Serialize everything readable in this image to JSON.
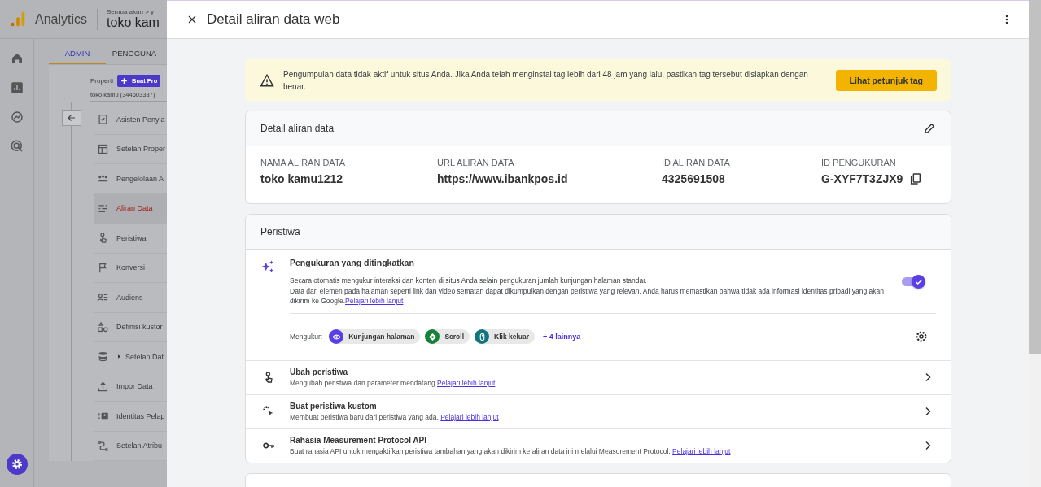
{
  "app": {
    "product": "Analytics",
    "breadcrumb": "Semua akun > y",
    "account": "toko kam",
    "tabs": [
      {
        "label": "ADMIN",
        "selected": true
      },
      {
        "label": "PENGGUNA",
        "selected": false
      }
    ],
    "property_label": "Properti",
    "create_button": "Buat Pro",
    "property": "toko kamu (344603387)",
    "menu": [
      {
        "label": "Asisten Penyia",
        "selected": false
      },
      {
        "label": "Setelan Proper",
        "selected": false
      },
      {
        "label": "Pengelolaan A",
        "selected": false
      },
      {
        "label": "Aliran Data",
        "selected": true
      },
      {
        "label": "Peristiwa",
        "selected": false
      },
      {
        "label": "Konversi",
        "selected": false
      },
      {
        "label": "Audiens",
        "selected": false
      },
      {
        "label": "Definisi kustor",
        "selected": false
      },
      {
        "label": "Setelan Dat",
        "selected": false,
        "expanded": false
      },
      {
        "label": "Impor Data",
        "selected": false
      },
      {
        "label": "Identitas Pelap",
        "selected": false
      },
      {
        "label": "Setelan Atribu",
        "selected": false
      }
    ]
  },
  "panel": {
    "title": "Detail aliran data web",
    "banner": {
      "text": "Pengumpulan data tidak aktif untuk situs Anda. Jika Anda telah menginstal tag lebih dari 48 jam yang lalu, pastikan tag tersebut disiapkan dengan benar.",
      "button": "Lihat petunjuk tag"
    },
    "stream_card": {
      "title": "Detail aliran data",
      "fields": [
        {
          "label": "NAMA ALIRAN DATA",
          "value": "toko kamu1212",
          "copy": false
        },
        {
          "label": "URL ALIRAN DATA",
          "value": "https://www.ibankpos.id",
          "copy": false
        },
        {
          "label": "ID ALIRAN DATA",
          "value": "4325691508",
          "copy": false
        },
        {
          "label": "ID PENGUKURAN",
          "value": "G-XYF7T3ZJX9",
          "copy": true
        }
      ]
    },
    "events_card": {
      "title": "Peristiwa",
      "enhanced": {
        "title": "Pengukuran yang ditingkatkan",
        "on": true,
        "description": "Secara otomatis mengukur interaksi dan konten di situs Anda selain pengukuran jumlah kunjungan halaman standar.\nData dari elemen pada halaman seperti link dan video sematan dapat dikumpulkan dengan peristiwa yang relevan. Anda harus memastikan bahwa tidak ada informasi identitas pribadi yang akan dikirim ke Google.",
        "link": "Pelajari lebih lanjut",
        "measures_label": "Mengukur:",
        "chips": [
          {
            "label": "Kunjungan halaman",
            "color": "#5b3fe6"
          },
          {
            "label": "Scroll",
            "color": "#188038"
          },
          {
            "label": "Klik keluar",
            "color": "#12757d"
          }
        ],
        "more": "+ 4 lainnya"
      },
      "rows": [
        {
          "title": "Ubah peristiwa",
          "description": "Mengubah peristiwa dan parameter mendatang",
          "link": "Pelajari lebih lanjut"
        },
        {
          "title": "Buat peristiwa kustom",
          "description": "Membuat peristiwa baru dari peristiwa yang ada.",
          "link": "Pelajari lebih lanjut"
        },
        {
          "title": "Rahasia Measurement Protocol API",
          "description": "Buat rahasia API untuk mengaktifkan peristiwa tambahan yang akan dikirim ke aliran data ini melalui Measurement Protocol.",
          "link": "Pelajari lebih lanjut"
        }
      ]
    }
  }
}
